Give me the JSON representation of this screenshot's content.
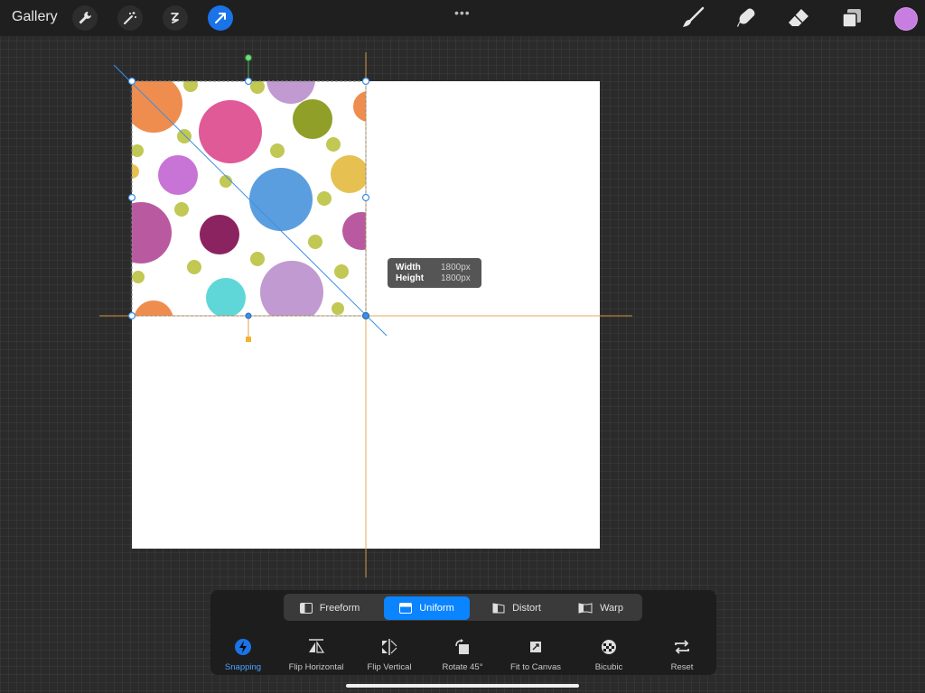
{
  "topbar": {
    "gallery_label": "Gallery",
    "tools": [
      "wrench-icon",
      "magic-wand-icon",
      "selection-icon",
      "transform-arrow-icon"
    ],
    "right_tools": [
      "brush-icon",
      "smudge-icon",
      "eraser-icon",
      "layers-icon"
    ],
    "current_color": "#c77ee0"
  },
  "transform_info": {
    "width_label": "Width",
    "width_value": "1800px",
    "height_label": "Height",
    "height_value": "1800px"
  },
  "bottom_panel": {
    "modes": [
      {
        "label": "Freeform",
        "active": false
      },
      {
        "label": "Uniform",
        "active": true
      },
      {
        "label": "Distort",
        "active": false
      },
      {
        "label": "Warp",
        "active": false
      }
    ],
    "actions": [
      {
        "label": "Snapping",
        "icon": "lightning-icon",
        "active": true
      },
      {
        "label": "Flip Horizontal",
        "icon": "flip-horizontal-icon"
      },
      {
        "label": "Flip Vertical",
        "icon": "flip-vertical-icon"
      },
      {
        "label": "Rotate 45°",
        "icon": "rotate-icon"
      },
      {
        "label": "Fit to Canvas",
        "icon": "fit-canvas-icon"
      },
      {
        "label": "Bicubic",
        "icon": "bicubic-icon"
      },
      {
        "label": "Reset",
        "icon": "reset-icon"
      }
    ]
  },
  "colors": {
    "accent": "#0a84ff",
    "snap_line": "#e0a24a",
    "guide_line": "#3a8ee6"
  }
}
